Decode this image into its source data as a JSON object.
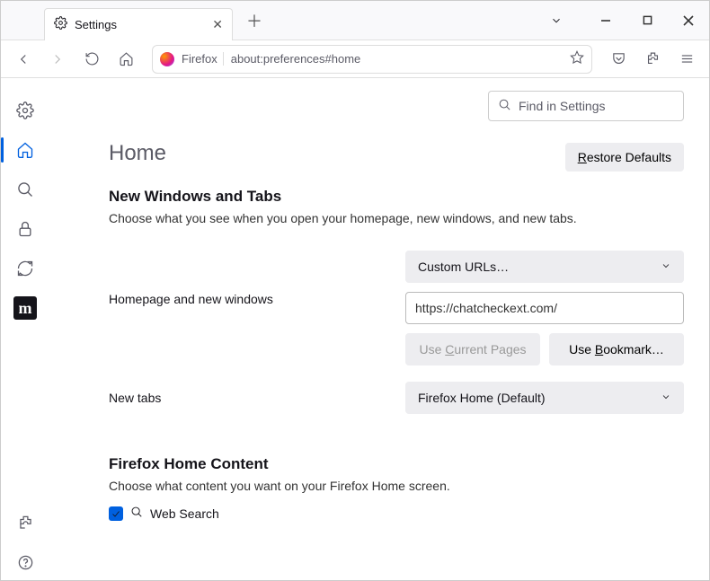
{
  "tab": {
    "title": "Settings"
  },
  "url": {
    "prefix": "Firefox",
    "address": "about:preferences#home"
  },
  "search": {
    "placeholder": "Find in Settings"
  },
  "heading": "Home",
  "restore_btn": {
    "prefix": "R",
    "suffix": "estore Defaults"
  },
  "section_nwtabs": {
    "title": "New Windows and Tabs",
    "desc": "Choose what you see when you open your homepage, new windows, and new tabs."
  },
  "homepage": {
    "label": "Homepage and new windows",
    "dropdown": "Custom URLs…",
    "url_value": "https://chatcheckext.com/",
    "use_current": {
      "pre": "Use ",
      "u": "C",
      "post": "urrent Pages"
    },
    "use_bookmark": {
      "pre": "Use ",
      "u": "B",
      "post": "ookmark…"
    }
  },
  "newtabs": {
    "label": "New tabs",
    "dropdown": "Firefox Home (Default)"
  },
  "section_fhc": {
    "title": "Firefox Home Content",
    "desc": "Choose what content you want on your Firefox Home screen.",
    "websearch": "Web Search"
  }
}
